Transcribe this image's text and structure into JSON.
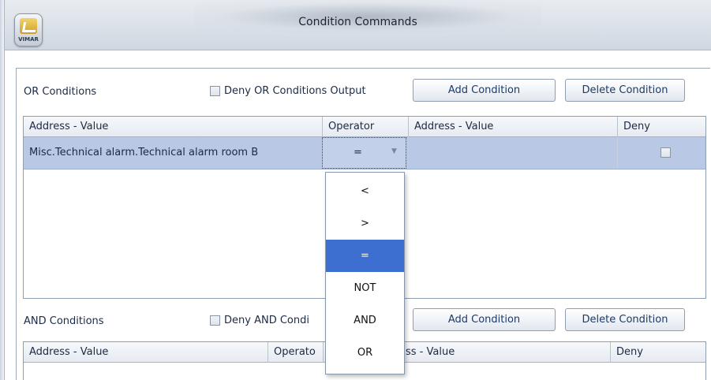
{
  "window": {
    "title": "Condition Commands",
    "logo_text": "VIMAR"
  },
  "or_section": {
    "label": "OR Conditions",
    "deny_label": "Deny OR Conditions Output",
    "add_button": "Add Condition",
    "delete_button": "Delete Condition",
    "columns": [
      "Address - Value",
      "Operator",
      "Address - Value",
      "Deny"
    ],
    "rows": [
      {
        "address_value": "Misc.Technical alarm.Technical alarm room B",
        "operator": "=",
        "address_value_2": "",
        "deny": false
      }
    ]
  },
  "and_section": {
    "label": "AND Conditions",
    "deny_label": "Deny AND Condi",
    "add_button": "Add Condition",
    "delete_button": "Delete Condition",
    "columns": [
      "Address - Value",
      "Operato",
      "ss - Value",
      "Deny"
    ]
  },
  "operator_dropdown": {
    "options": [
      "<",
      ">",
      "=",
      "NOT",
      "AND",
      "OR"
    ],
    "selected": "="
  }
}
